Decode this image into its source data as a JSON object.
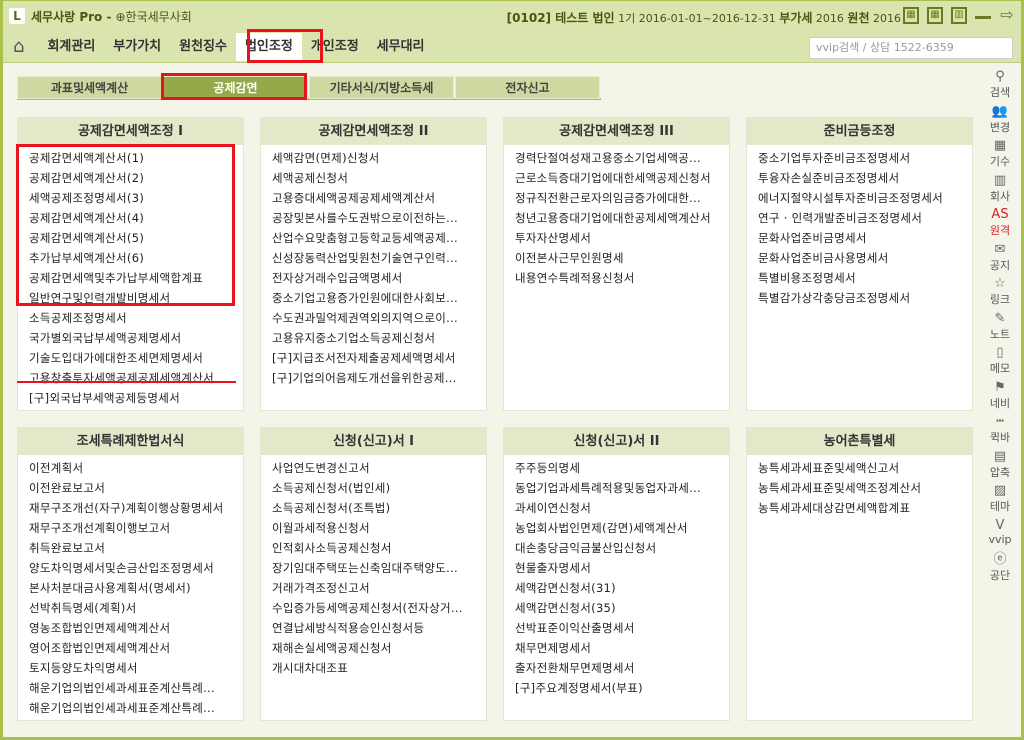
{
  "titlebar": {
    "logo": "L",
    "app_title": "세무사랑 Pro -",
    "org": "⊕한국세무사회",
    "info_code": "[0102] 테스트 법인",
    "info_period": "1기 2016-01-01~2016-12-31",
    "vat_label": "부가세",
    "vat_year": "2016",
    "wh_label": "원천",
    "wh_year": "2016"
  },
  "nav": {
    "items": [
      "회계관리",
      "부가가치",
      "원천징수",
      "법인조정",
      "개인조정",
      "세무대리"
    ],
    "active": 3,
    "search_placeholder": "vvip검색 / 상담 1522-6359"
  },
  "subtabs": {
    "items": [
      "과표및세액계산",
      "공제감면",
      "기타서식/지방소득세",
      "전자신고"
    ],
    "active": 1
  },
  "panels": [
    {
      "title": "공제감면세액조정 I",
      "items": [
        "공제감면세액계산서(1)",
        "공제감면세액계산서(2)",
        "세액공제조정명세서(3)",
        "공제감면세액계산서(4)",
        "공제감면세액계산서(5)",
        "추가납부세액계산서(6)",
        "공제감면세액및추가납부세액합계표",
        "일반연구및인력개발비명세서",
        "소득공제조정명세서",
        "국가별외국납부세액공제명세서",
        "기술도입대가에대한조세면제명세서",
        "고용창출투자세액공제공제세액계산서",
        "[구]외국납부세액공제등명세서"
      ]
    },
    {
      "title": "공제감면세액조정 II",
      "items": [
        "세액감면(면제)신청서",
        "세액공제신청서",
        "고용증대세액공제공제세액계산서",
        "공장및본사를수도권밖으로이전하는...",
        "산업수요맞춤형고등학교등세액공제...",
        "신성장동력산업및원천기술연구인력...",
        "전자상거래수입금액명세서",
        "중소기업고용증가인원에대한사회보...",
        "수도권과밀억제권역외의지역으로이...",
        "고용유지중소기업소득공제신청서",
        "[구]지급조서전자제출공제세액명세서",
        "[구]기업의어음제도개선을위한공제..."
      ]
    },
    {
      "title": "공제감면세액조정 III",
      "items": [
        "경력단절여성재고용중소기업세액공...",
        "근로소득증대기업에대한세액공제신청서",
        "정규직전환근로자의임금증가에대한...",
        "청년고용증대기업에대한공제세액계산서",
        "투자자산명세서",
        "이전본사근무인원명세",
        "내용연수특례적용신청서"
      ]
    },
    {
      "title": "준비금등조정",
      "items": [
        "중소기업투자준비금조정명세서",
        "투융자손실준비금조정명세서",
        "에너지절약시설투자준비금조정명세서",
        "연구 · 인력개발준비금조정명세서",
        "문화사업준비금명세서",
        "문화사업준비금사용명세서",
        "특별비용조정명세서",
        "특별감가상각충당금조정명세서"
      ]
    },
    {
      "title": "조세특례제한법서식",
      "items": [
        "이전계획서",
        "이전완료보고서",
        "재무구조개선(자구)계획이행상황명세서",
        "재무구조개선계획이행보고서",
        "취득완료보고서",
        "양도차익명세서및손금산입조정명세서",
        "본사처분대금사용계획서(명세서)",
        "선박취득명세(계획)서",
        "영농조합법인면제세액계산서",
        "영어조합법인면제세액계산서",
        "토지등양도차익명세서",
        "해운기업의법인세과세표준계산특례...",
        "해운기업의법인세과세표준계산특례..."
      ]
    },
    {
      "title": "신청(신고)서 I",
      "items": [
        "사업연도변경신고서",
        "소득공제신청서(법인세)",
        "소득공제신청서(조특법)",
        "이월과세적용신청서",
        "인적회사소득공제신청서",
        "장기임대주택또는신축임대주택양도...",
        "거래가격조정신고서",
        "수입증가등세액공제신청서(전자상거...",
        "연결납세방식적용승인신청서등",
        "재해손실세액공제신청서",
        "개시대차대조표"
      ]
    },
    {
      "title": "신청(신고)서 II",
      "items": [
        "주주등의명세",
        "동업기업과세특례적용및동업자과세...",
        "과세이연신청서",
        "농업회사법인면제(감면)세액계산서",
        "대손충당금익금불산입신청서",
        "현물출자명세서",
        "세액감면신청서(31)",
        "세액감면신청서(35)",
        "선박표준이익산출명세서",
        "채무면제명세서",
        "출자전환채무면제명세서",
        "[구]주요계정명세서(부표)"
      ]
    },
    {
      "title": "농어촌특별세",
      "items": [
        "농특세과세표준및세액신고서",
        "농특세과세표준및세액조정계산서",
        "농특세과세대상감면세액합계표"
      ]
    }
  ],
  "sidebar": [
    {
      "label": "검색",
      "icon": "search-icon",
      "glyph": "⚲"
    },
    {
      "label": "변경",
      "icon": "users-icon",
      "glyph": "👥"
    },
    {
      "label": "기수",
      "icon": "calendar-icon",
      "glyph": "▦"
    },
    {
      "label": "회사",
      "icon": "building-icon",
      "glyph": "▥"
    },
    {
      "label": "원격",
      "icon": "remote-icon",
      "glyph": "AS",
      "color": "#d8202c"
    },
    {
      "label": "공지",
      "icon": "notice-icon",
      "glyph": "✉"
    },
    {
      "label": "링크",
      "icon": "star-icon",
      "glyph": "☆"
    },
    {
      "label": "노트",
      "icon": "note-icon",
      "glyph": "✎"
    },
    {
      "label": "메모",
      "icon": "memo-icon",
      "glyph": "▯"
    },
    {
      "label": "네비",
      "icon": "signpost-icon",
      "glyph": "⚑"
    },
    {
      "label": "퀵바",
      "icon": "quickbar-icon",
      "glyph": "┅"
    },
    {
      "label": "압축",
      "icon": "zip-icon",
      "glyph": "▤"
    },
    {
      "label": "테마",
      "icon": "theme-icon",
      "glyph": "▨"
    },
    {
      "label": "vvip",
      "icon": "vvip-icon",
      "glyph": "V"
    },
    {
      "label": "공단",
      "icon": "e-icon",
      "glyph": "ⓔ"
    }
  ]
}
